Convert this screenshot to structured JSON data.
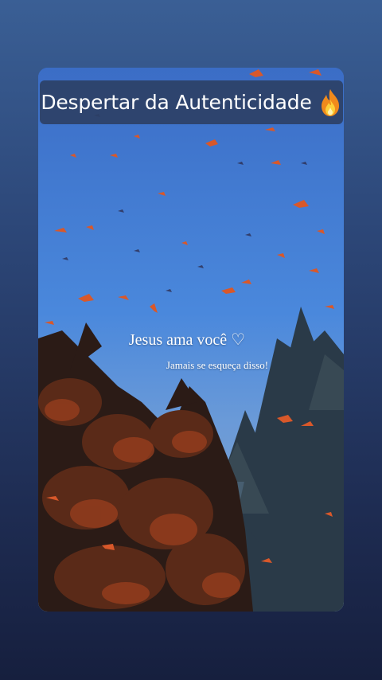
{
  "story": {
    "title": "Despertar da Autenticidade",
    "title_icon": "fire-emoji",
    "caption_main": "Jesus ama você ♡",
    "caption_sub": "Jamais se esqueça disso!",
    "photo_subject": "butterflies-over-trees"
  },
  "colors": {
    "background_top": "#3a5f95",
    "background_bottom": "#161f3e",
    "banner": "#2c4066",
    "sky": "#4a86da",
    "butterfly": "#d8582a"
  }
}
